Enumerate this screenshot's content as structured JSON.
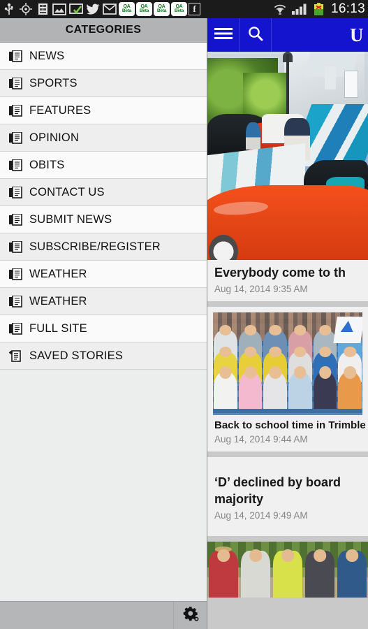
{
  "statusbar": {
    "icons": [
      {
        "name": "usb-icon"
      },
      {
        "name": "gps-location-icon"
      },
      {
        "name": "document-icon"
      },
      {
        "name": "image-icon"
      },
      {
        "name": "screen-check-icon"
      },
      {
        "name": "twitter-icon"
      },
      {
        "name": "gmail-icon"
      }
    ],
    "qa_beta": [
      {
        "top": "QA",
        "bottom": "Beta"
      },
      {
        "top": "QA",
        "bottom": "Beta"
      },
      {
        "top": "QA",
        "bottom": "Beta"
      },
      {
        "top": "QA",
        "bottom": "Beta"
      }
    ],
    "facebook_glyph": "f",
    "wifi_icon": "wifi-icon",
    "signal_icon": "cellular-signal-icon",
    "battery_icon": "battery-error-icon",
    "clock": "16:13"
  },
  "drawer": {
    "title": "CATEGORIES",
    "items": [
      {
        "label": "NEWS",
        "icon": "documents-icon"
      },
      {
        "label": "SPORTS",
        "icon": "documents-icon"
      },
      {
        "label": "FEATURES",
        "icon": "documents-icon"
      },
      {
        "label": "OPINION",
        "icon": "documents-icon"
      },
      {
        "label": "OBITS",
        "icon": "documents-icon"
      },
      {
        "label": "CONTACT US",
        "icon": "documents-icon"
      },
      {
        "label": "SUBMIT NEWS",
        "icon": "documents-icon"
      },
      {
        "label": "SUBSCRIBE/REGISTER",
        "icon": "documents-icon"
      },
      {
        "label": "WEATHER",
        "icon": "documents-icon"
      },
      {
        "label": "WEATHER",
        "icon": "documents-icon"
      },
      {
        "label": "FULL SITE",
        "icon": "documents-icon"
      },
      {
        "label": "SAVED STORIES",
        "icon": "document-add-icon"
      }
    ],
    "settings_icon": "gear-icon"
  },
  "appbar": {
    "menu_icon": "hamburger-menu-icon",
    "search_icon": "search-icon",
    "logo_glyph": "U",
    "accent_color": "#1414cf"
  },
  "feed": {
    "articles": [
      {
        "headline": "Everybody come to th",
        "timestamp": "Aug 14, 2014 9:35 AM",
        "image": "classic-car-show-photo"
      },
      {
        "headline": "Back to school time in Trimble",
        "timestamp": "Aug 14, 2014 9:44 AM",
        "image": "students-group-photo"
      },
      {
        "headline_line1": "‘D’ declined by board",
        "headline_line2": "majority",
        "timestamp": "Aug 14, 2014 9:49 AM",
        "image": null
      },
      {
        "headline": "",
        "timestamp": "",
        "image": "men-outdoors-photo"
      }
    ]
  }
}
